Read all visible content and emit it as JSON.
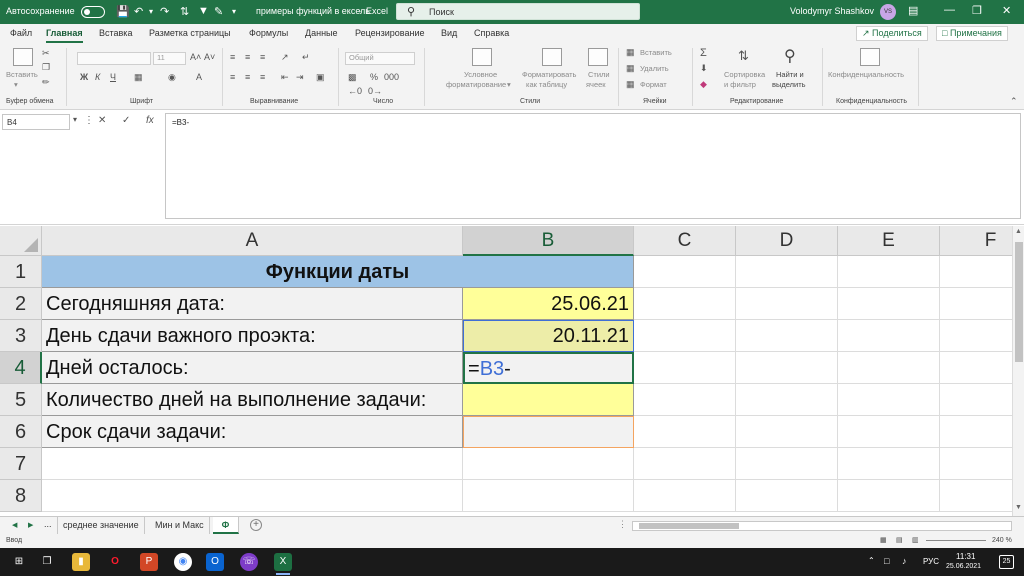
{
  "titlebar": {
    "autosave_label": "Автосохранение",
    "doc_title": "примеры функций в ексель",
    "app_name": "Excel",
    "search_placeholder": "Поиск",
    "user_name": "Volodymyr Shashkov",
    "user_initials": "VS"
  },
  "menu": {
    "tabs": [
      "Файл",
      "Главная",
      "Вставка",
      "Разметка страницы",
      "Формулы",
      "Данные",
      "Рецензирование",
      "Вид",
      "Справка"
    ],
    "active": "Главная",
    "share_label": "Поделиться",
    "comments_label": "Примечания"
  },
  "ribbon": {
    "groups": {
      "clipboard": "Буфер обмена",
      "font": "Шрифт",
      "alignment": "Выравнивание",
      "number": "Число",
      "styles": "Стили",
      "cells": "Ячейки",
      "editing": "Редактирование",
      "sensitivity": "Конфиденциальность"
    },
    "paste_label": "Вставить",
    "font_size": "11",
    "number_format": "Общий",
    "cond_format_l1": "Условное",
    "cond_format_l2": "форматирование",
    "format_table_l1": "Форматировать",
    "format_table_l2": "как таблицу",
    "cell_styles_l1": "Стили",
    "cell_styles_l2": "ячеек",
    "insert_label": "Вставить",
    "delete_label": "Удалить",
    "format_label": "Формат",
    "sort_l1": "Сортировка",
    "sort_l2": "и фильтр",
    "find_l1": "Найти и",
    "find_l2": "выделить",
    "sensitivity_label": "Конфиденциальность"
  },
  "formula_bar": {
    "name_box": "B4",
    "formula": "=B3-"
  },
  "grid": {
    "columns": [
      "A",
      "B",
      "C",
      "D",
      "E",
      "F"
    ],
    "rows": [
      "1",
      "2",
      "3",
      "4",
      "5",
      "6",
      "7",
      "8"
    ],
    "title": "Функции даты",
    "a2": "Сегодняшняя дата:",
    "b2": "25.06.21",
    "a3": "День сдачи важного проэкта:",
    "b3": "20.11.21",
    "a4": "Дней осталось:",
    "b4_eq": "=",
    "b4_ref": "B3",
    "b4_op": "-",
    "a5": "Количество дней на выполнение задачи:",
    "a6": "Срок сдачи задачи:"
  },
  "sheets": {
    "ellipsis": "...",
    "tabs": [
      "среднее значение",
      "Мин и Макс",
      "Ф"
    ],
    "active": "Ф",
    "add": "+"
  },
  "statusbar": {
    "mode": "Ввод",
    "zoom": "240 %"
  },
  "taskbar": {
    "lang": "РУС",
    "time": "11:31",
    "date": "25.06.2021",
    "notif_count": "25"
  },
  "colors": {
    "excel_green": "#217346",
    "title_fill": "#9dc3e6",
    "input_fill": "#ffff99",
    "ref_blue": "#3f6fd6"
  }
}
